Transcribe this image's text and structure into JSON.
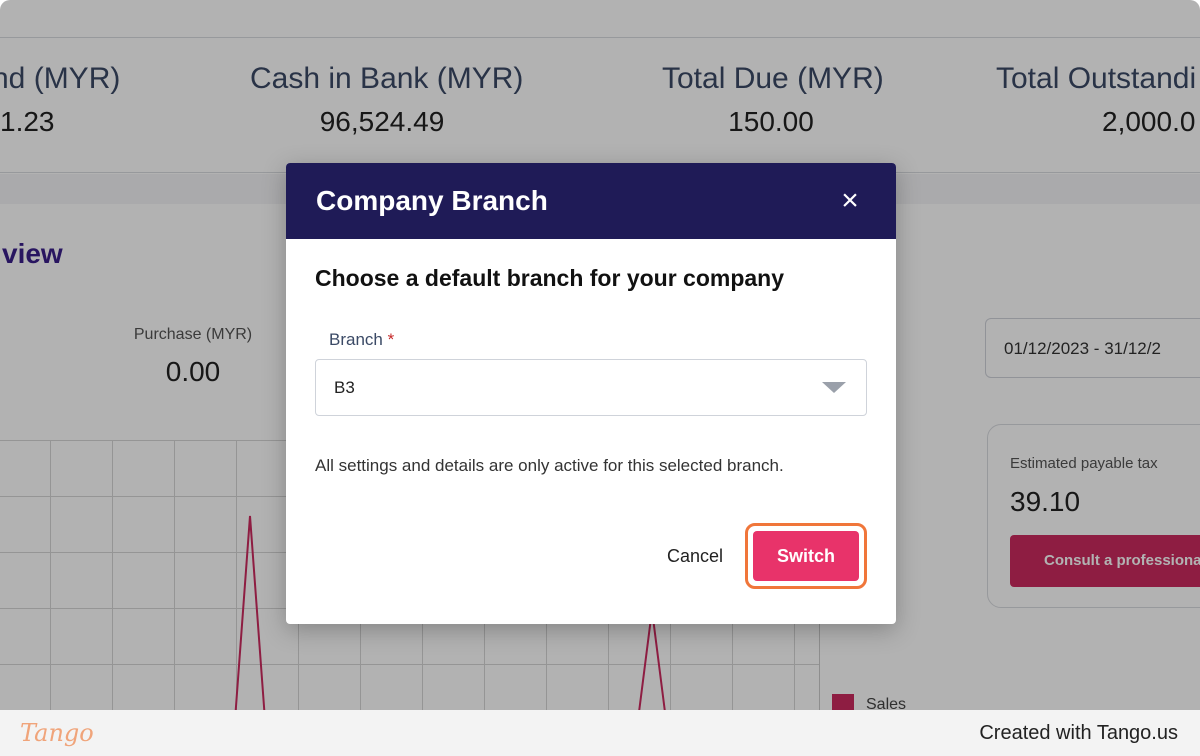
{
  "stats": [
    {
      "label": "nd (MYR)",
      "value": "1.23"
    },
    {
      "label": "Cash in Bank (MYR)",
      "value": "96,524.49"
    },
    {
      "label": "Total Due (MYR)",
      "value": "150.00"
    },
    {
      "label": "Total Outstandi",
      "value": "2,000.0"
    }
  ],
  "overview_title": "view",
  "purchase": {
    "label": "Purchase (MYR)",
    "value": "0.00"
  },
  "date_range": "01/12/2023 - 31/12/2",
  "tax": {
    "label": "Estimated payable tax",
    "value": "39.10",
    "button": "Consult a professiona"
  },
  "legend": {
    "sales": "Sales"
  },
  "modal": {
    "title": "Company Branch",
    "close_icon": "×",
    "subtitle": "Choose a default branch for your company",
    "field_label": "Branch",
    "required_mark": "*",
    "selected_branch": "B3",
    "note": "All settings and details are only active for this selected branch.",
    "cancel_label": "Cancel",
    "switch_label": "Switch"
  },
  "footer": {
    "logo": "Tango",
    "credit": "Created with Tango.us"
  },
  "colors": {
    "header": "#1f1b57",
    "primary": "#e8336a",
    "highlight": "#f0763a"
  }
}
